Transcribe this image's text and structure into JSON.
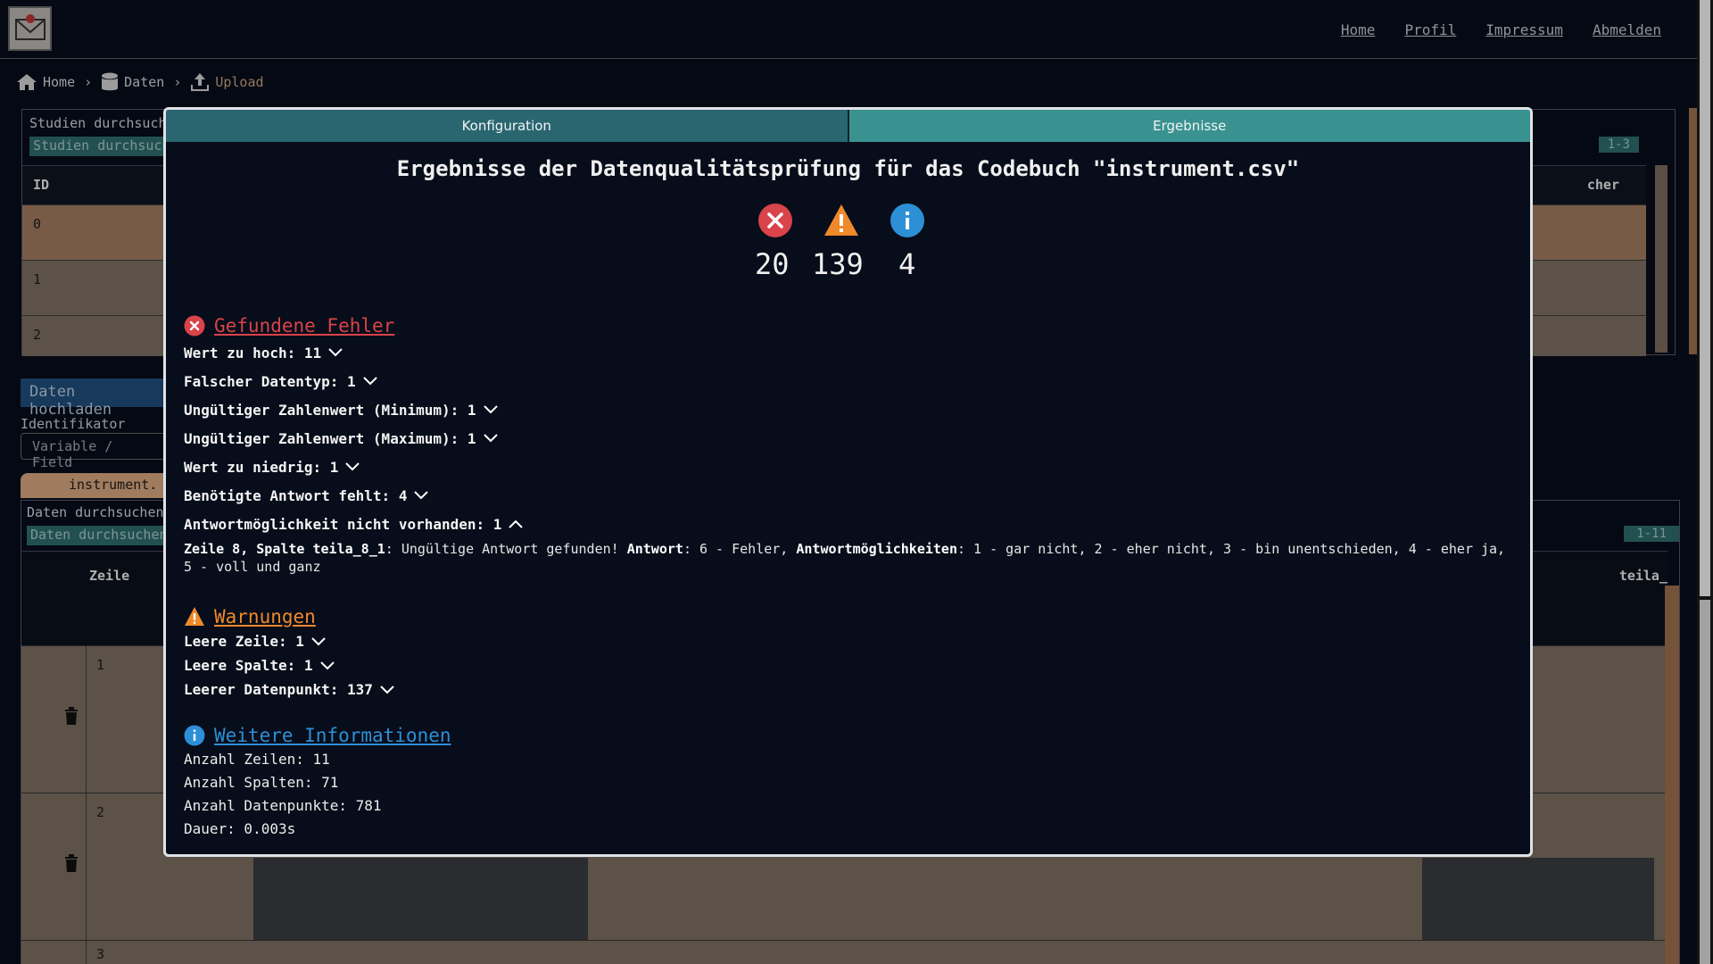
{
  "nav": {
    "home": "Home",
    "profile": "Profil",
    "imprint": "Impressum",
    "logout": "Abmelden"
  },
  "breadcrumb": {
    "home": "Home",
    "data": "Daten",
    "upload": "Upload"
  },
  "studies": {
    "search_label": "Studien durchsuchen",
    "search_placeholder": "Studien durchsuchen",
    "count": "1-3",
    "col_id": "ID",
    "col_right": "cher",
    "rows": [
      "0",
      "1",
      "2"
    ]
  },
  "upload": {
    "button": "Daten hochladen",
    "ident_label": "Identifikator",
    "ident_placeholder": "Variable / Field",
    "file_tab": "instrument."
  },
  "data_table": {
    "search_label": "Daten durchsuchen",
    "search_placeholder": "Daten durchsuchen",
    "count": "1-11",
    "col_row": "Zeile",
    "col_right": "teila_",
    "rows": [
      "1",
      "2",
      "3"
    ]
  },
  "modal": {
    "tabs": {
      "config": "Konfiguration",
      "results": "Ergebnisse"
    },
    "title": "Ergebnisse der Datenqualitätsprüfung für das Codebuch \"instrument.csv\"",
    "summary": {
      "errors": "20",
      "warnings": "139",
      "infos": "4"
    },
    "errors_section": {
      "title": "Gefundene Fehler",
      "items": [
        "Wert zu hoch: 11",
        "Falscher Datentyp: 1",
        "Ungültiger Zahlenwert (Minimum): 1",
        "Ungültiger Zahlenwert (Maximum): 1",
        "Wert zu niedrig: 1",
        "Benötigte Antwort fehlt: 4",
        "Antwortmöglichkeit nicht vorhanden: 1"
      ],
      "detail": {
        "location": "Zeile 8, Spalte teila_8_1",
        "message": ": Ungültige Antwort gefunden! ",
        "answer_label": "Antwort",
        "answer_value": ": 6 - Fehler, ",
        "options_label": "Antwortmöglichkeiten",
        "options_value": ": 1 - gar nicht, 2 - eher nicht, 3 - bin unentschieden, 4 - eher ja, 5 - voll und ganz"
      }
    },
    "warnings_section": {
      "title": "Warnungen",
      "items": [
        "Leere Zeile: 1",
        "Leere Spalte: 1",
        "Leerer Datenpunkt: 137"
      ]
    },
    "info_section": {
      "title": "Weitere Informationen",
      "lines": [
        "Anzahl Zeilen: 11",
        "Anzahl Spalten: 71",
        "Anzahl Datenpunkte: 781",
        "Dauer: 0.003s"
      ]
    }
  },
  "colors": {
    "error": "#d9434a",
    "warning": "#f0892a",
    "info": "#2d8fd6",
    "tab_config": "#2a6670",
    "tab_results": "#3a9290"
  }
}
